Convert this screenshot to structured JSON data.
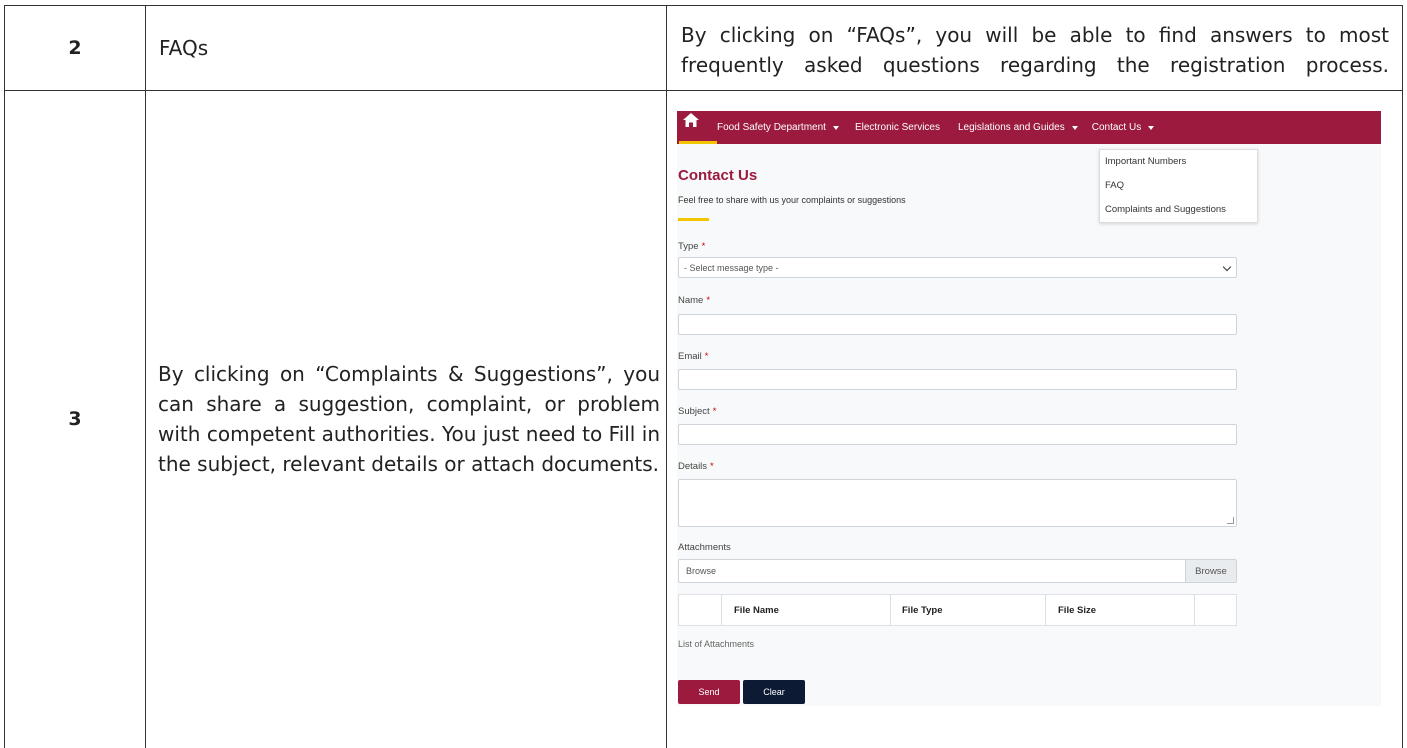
{
  "rows": [
    {
      "number": "2",
      "title": "FAQs",
      "description": "By clicking on “FAQs”, you will be able to find answers to most frequently asked questions regarding the registration process."
    },
    {
      "number": "3",
      "description": "By clicking on “Complaints & Suggestions”, you can share a suggestion, complaint, or problem with competent authorities. You just need to Fill in the subject, relevant details or attach documents."
    }
  ],
  "screenshot": {
    "nav": {
      "home_icon": "home-icon",
      "items": [
        "Food Safety Department",
        "Electronic Services",
        "Legislations and Guides",
        "Contact Us"
      ]
    },
    "dropdown": [
      "Important Numbers",
      "FAQ",
      "Complaints and Suggestions"
    ],
    "page_title": "Contact Us",
    "page_subtitle": "Feel free to share with us your complaints or suggestions",
    "form": {
      "type_label": "Type",
      "type_placeholder": "- Select message type -",
      "name_label": "Name",
      "email_label": "Email",
      "subject_label": "Subject",
      "details_label": "Details",
      "required_mark": "*",
      "attachments_label": "Attachments",
      "browse_placeholder": "Browse",
      "browse_button": "Browse",
      "table_headers": [
        "File Name",
        "File Type",
        "File Size"
      ],
      "list_label": "List of Attachments",
      "send_label": "Send",
      "clear_label": "Clear"
    },
    "colors": {
      "brand": "#9b1a3e",
      "accent": "#f2c500",
      "dark_button": "#0c1b33"
    }
  }
}
